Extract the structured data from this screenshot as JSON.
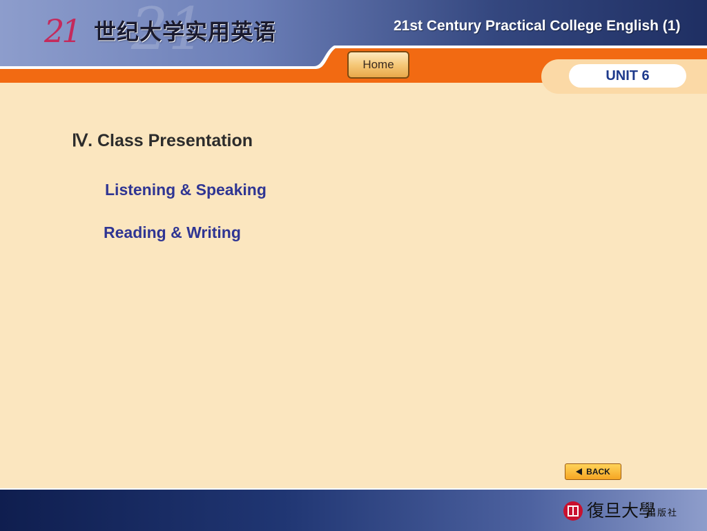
{
  "header": {
    "logo_number": "21",
    "logo_text": "世纪大学实用英语",
    "title": "21st Century Practical College English (1)",
    "home_label": "Home"
  },
  "unit": {
    "label": "UNIT 6"
  },
  "main": {
    "section_title": "Ⅳ. Class Presentation",
    "links": [
      {
        "label": "Listening & Speaking"
      },
      {
        "label": "Reading & Writing"
      }
    ]
  },
  "navigation": {
    "back_label": "BACK"
  },
  "footer": {
    "publisher_name": "復旦大學",
    "publisher_suffix": "出版社"
  },
  "colors": {
    "background": "#fbe6bf",
    "orange_band": "#f26a12",
    "accent_blue": "#2f3593",
    "header_dark": "#1f2f63"
  }
}
